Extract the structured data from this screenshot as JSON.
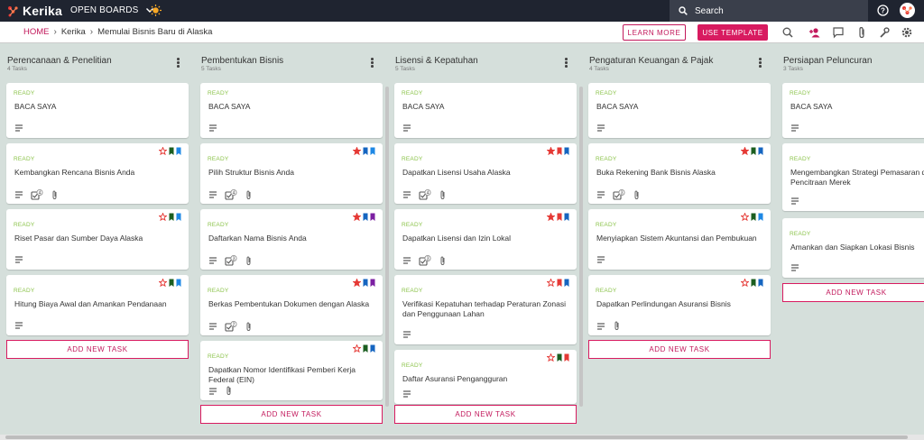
{
  "app": {
    "name": "Kerika",
    "open_boards": "OPEN BOARDS",
    "search_placeholder": "Search"
  },
  "breadcrumb": {
    "home": "HOME",
    "org": "Kerika",
    "board": "Memulai Bisnis Baru di Alaska"
  },
  "buttons": {
    "learn_more": "LEARN MORE",
    "use_template": "USE TEMPLATE"
  },
  "add_task_label": "ADD NEW TASK",
  "columns": [
    {
      "title": "Perencanaan & Penelitian",
      "count": "4 Tasks",
      "cards": [
        {
          "status": "READY",
          "title": "BACA SAYA"
        },
        {
          "status": "READY",
          "title": "Kembangkan Rencana Bisnis Anda",
          "checklist": "4"
        },
        {
          "status": "READY",
          "title": "Riset Pasar dan Sumber Daya Alaska"
        },
        {
          "status": "READY",
          "title": "Hitung Biaya Awal dan Amankan Pendanaan"
        }
      ]
    },
    {
      "title": "Pembentukan Bisnis",
      "count": "5 Tasks",
      "cards": [
        {
          "status": "READY",
          "title": "BACA SAYA"
        },
        {
          "status": "READY",
          "title": "Pilih Struktur Bisnis Anda",
          "checklist": "4"
        },
        {
          "status": "READY",
          "title": "Daftarkan Nama Bisnis Anda",
          "checklist": "3"
        },
        {
          "status": "READY",
          "title": "Berkas Pembentukan Dokumen dengan Alaska",
          "checklist": "2"
        },
        {
          "status": "READY",
          "title": "Dapatkan Nomor Identifikasi Pemberi Kerja Federal (EIN)"
        }
      ]
    },
    {
      "title": "Lisensi & Kepatuhan",
      "count": "5 Tasks",
      "cards": [
        {
          "status": "READY",
          "title": "BACA SAYA"
        },
        {
          "status": "READY",
          "title": "Dapatkan Lisensi Usaha Alaska",
          "checklist": "4"
        },
        {
          "status": "READY",
          "title": "Dapatkan Lisensi dan Izin Lokal",
          "checklist": "3"
        },
        {
          "status": "READY",
          "title": "Verifikasi Kepatuhan terhadap Peraturan Zonasi dan Penggunaan Lahan"
        },
        {
          "status": "READY",
          "title": "Daftar Asuransi Pengangguran"
        }
      ]
    },
    {
      "title": "Pengaturan Keuangan & Pajak",
      "count": "4 Tasks",
      "cards": [
        {
          "status": "READY",
          "title": "BACA SAYA"
        },
        {
          "status": "READY",
          "title": "Buka Rekening Bank Bisnis Alaska",
          "checklist": "3"
        },
        {
          "status": "READY",
          "title": "Menyiapkan Sistem Akuntansi dan Pembukuan"
        },
        {
          "status": "READY",
          "title": "Dapatkan Perlindungan Asuransi Bisnis"
        }
      ]
    },
    {
      "title": "Persiapan Peluncuran",
      "count": "3 Tasks",
      "cards": [
        {
          "status": "READY",
          "title": "BACA SAYA"
        },
        {
          "status": "READY",
          "title": "Mengembangkan Strategi Pemasaran dan Pencitraan Merek"
        },
        {
          "status": "READY",
          "title": "Amankan dan Siapkan Lokasi Bisnis"
        }
      ]
    }
  ],
  "colors": {
    "accent": "#d81b60",
    "ready": "#8bc34a",
    "topbar": "#1f2430",
    "board_bg": "#d5dfdb"
  }
}
